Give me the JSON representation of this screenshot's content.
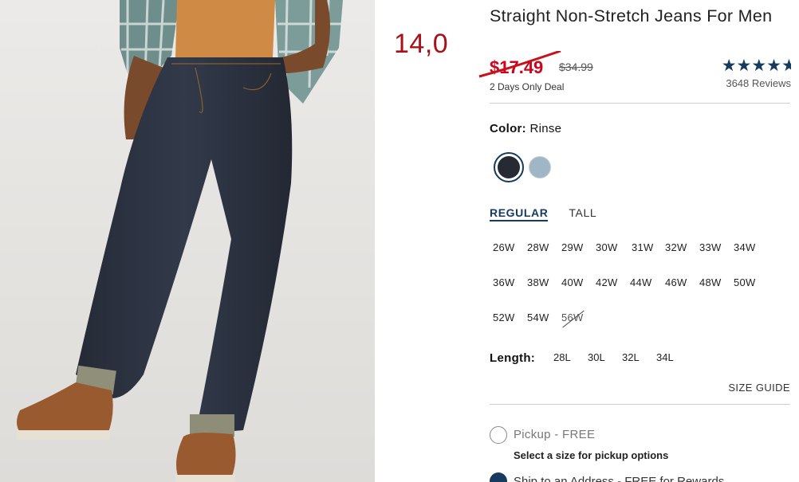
{
  "annotation": "14,0",
  "product": {
    "title": "Straight Non-Stretch Jeans For Men",
    "sale_price": "$17.49",
    "original_price": "$34.99",
    "deal_text": "2 Days Only Deal",
    "rating": 4.5,
    "reviews": "3648 Reviews"
  },
  "color": {
    "label": "Color:",
    "value": "Rinse",
    "swatches": [
      {
        "name": "Rinse",
        "hex": "#262a33",
        "selected": true
      },
      {
        "name": "Light wash",
        "hex": "#9fb6c7",
        "selected": false
      }
    ]
  },
  "fit_tabs": [
    {
      "label": "REGULAR",
      "active": true
    },
    {
      "label": "TALL",
      "active": false
    }
  ],
  "waist_sizes": [
    [
      "26W",
      "28W",
      "29W",
      "30W",
      "31W",
      "32W",
      "33W",
      "34W"
    ],
    [
      "36W",
      "38W",
      "40W",
      "42W",
      "44W",
      "46W",
      "48W",
      "50W"
    ],
    [
      "52W",
      "54W",
      "56W"
    ]
  ],
  "unavailable_sizes": [
    "56W"
  ],
  "length": {
    "label": "Length:",
    "options": [
      "28L",
      "30L",
      "32L",
      "34L"
    ]
  },
  "size_guide": "SIZE GUIDE",
  "fulfillment": {
    "pickup_label": "Pickup - FREE",
    "pickup_note": "Select a size for pickup options",
    "ship_label": "Ship to an Address - FREE for Rewards"
  },
  "colors": {
    "accent": "#163b5e",
    "sale": "#d0021b",
    "annotation": "#a8101a"
  }
}
